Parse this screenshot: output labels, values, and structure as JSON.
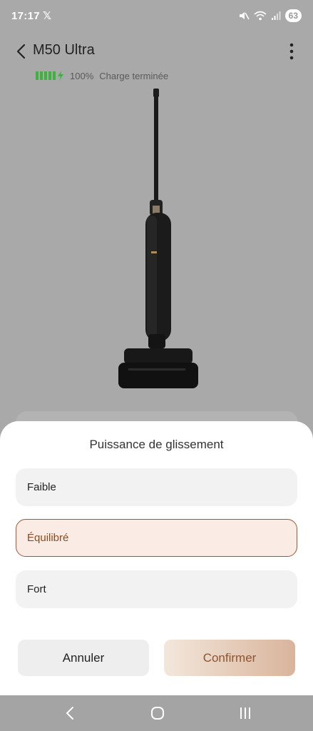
{
  "status_bar": {
    "time": "17:17",
    "notification_icon": "x-logo-icon",
    "battery_level": "63",
    "icons": [
      "mute-icon",
      "wifi-icon",
      "signal-icon",
      "battery-icon"
    ]
  },
  "header": {
    "title": "M50 Ultra"
  },
  "device": {
    "battery_percent": "100%",
    "charge_status": "Charge terminée",
    "battery_color": "#3fb13f"
  },
  "sheet": {
    "title": "Puissance de glissement",
    "options": [
      {
        "label": "Faible",
        "selected": false
      },
      {
        "label": "Équilibré",
        "selected": true
      },
      {
        "label": "Fort",
        "selected": false
      }
    ],
    "cancel_label": "Annuler",
    "confirm_label": "Confirmer"
  },
  "colors": {
    "accent": "#9a5a35",
    "selected_bg": "#faece4"
  },
  "navbar": {
    "icons": [
      "back-nav-icon",
      "home-nav-icon",
      "recents-nav-icon"
    ]
  }
}
